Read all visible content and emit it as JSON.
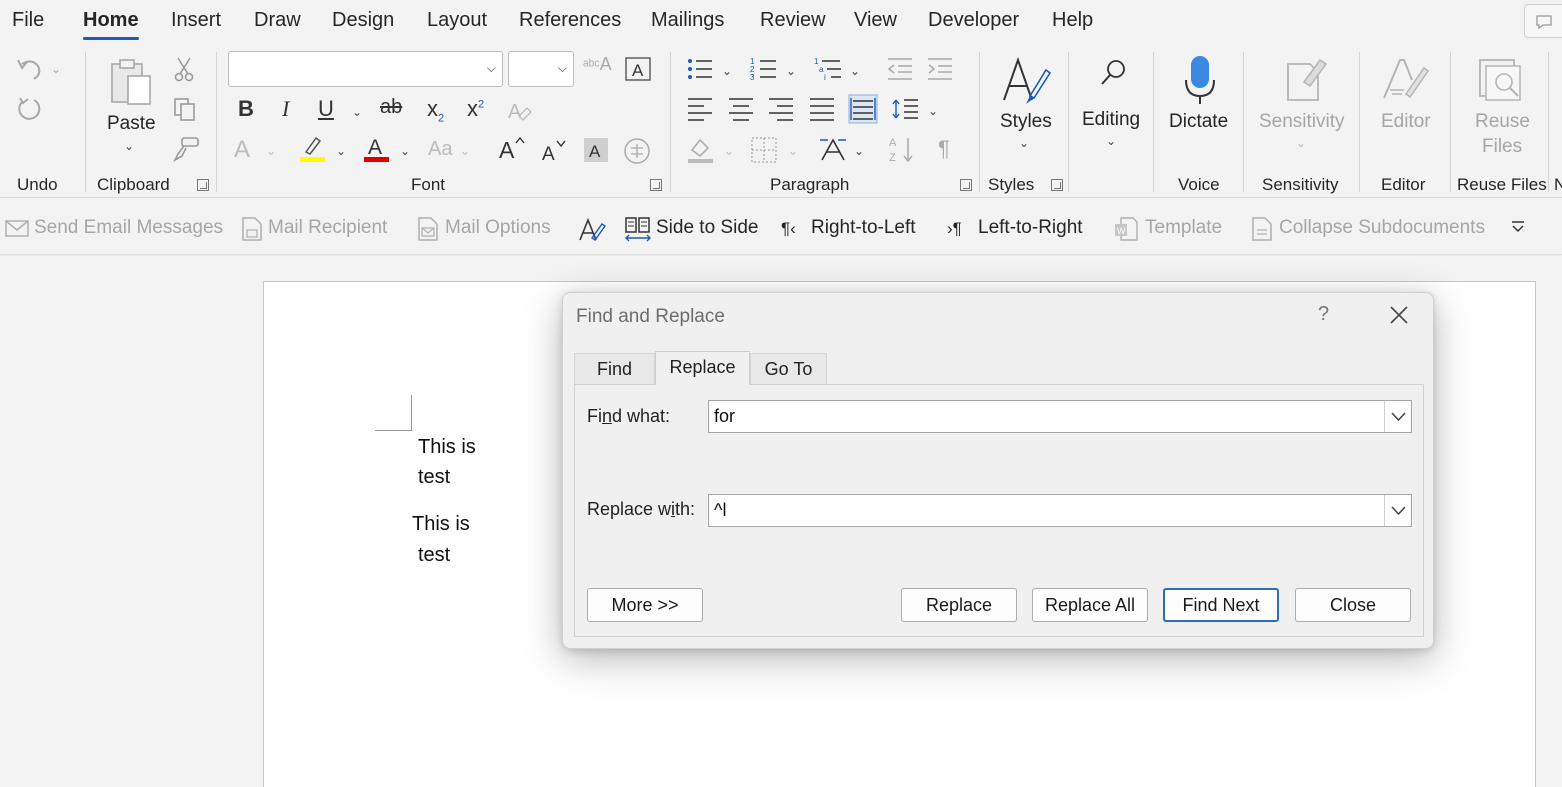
{
  "tabs": [
    "File",
    "Home",
    "Insert",
    "Draw",
    "Design",
    "Layout",
    "References",
    "Mailings",
    "Review",
    "View",
    "Developer",
    "Help"
  ],
  "active_tab": "Home",
  "ribbon": {
    "groups": {
      "undo": "Undo",
      "clipboard": "Clipboard",
      "font": "Font",
      "paragraph": "Paragraph",
      "styles": "Styles",
      "voice": "Voice",
      "sensitivity": "Sensitivity",
      "editor": "Editor",
      "reuse_files": "Reuse Files",
      "truncated": "N"
    },
    "paste_label": "Paste",
    "styles_label": "Styles",
    "editing_label": "Editing",
    "dictate_label": "Dictate",
    "sensitivity_label": "Sensitivity",
    "editor_label": "Editor",
    "reuse_files_label_1": "Reuse",
    "reuse_files_label_2": "Files",
    "font_name_value": "",
    "font_size_value": "",
    "bold": "B",
    "italic": "I",
    "underline": "U",
    "strike": "ab",
    "subscript": "x",
    "subscript_sub": "2",
    "superscript": "x",
    "superscript_sup": "2",
    "change_case": "Aa",
    "grow_font": "A",
    "shrink_font": "A",
    "font_color_letter": "A",
    "highlight_color": "#ffff00",
    "font_color": "#e00000",
    "accent_color": "#185abd"
  },
  "qat": {
    "send_email": "Send Email Messages",
    "mail_recipient": "Mail Recipient",
    "mail_options": "Mail Options",
    "side_to_side": "Side to Side",
    "right_to_left": "Right-to-Left",
    "left_to_right": "Left-to-Right",
    "template": "Template",
    "collapse_subdocuments": "Collapse Subdocuments"
  },
  "document": {
    "line1a": "This is",
    "line1b": "test",
    "line2a": "This is",
    "line2b": "test"
  },
  "dialog": {
    "title": "Find and Replace",
    "help": "?",
    "tabs": {
      "find": "Find",
      "replace": "Replace",
      "goto": "Go To"
    },
    "find_label_pre": "Fi",
    "find_label_u": "n",
    "find_label_post": "d what:",
    "find_value": "for",
    "replace_label_pre": "Replace w",
    "replace_label_u": "i",
    "replace_label_post": "th:",
    "replace_value": "^l",
    "buttons": {
      "more": "More >>",
      "replace": "Replace",
      "replace_all": "Replace All",
      "find_next": "Find Next",
      "close": "Close"
    }
  }
}
